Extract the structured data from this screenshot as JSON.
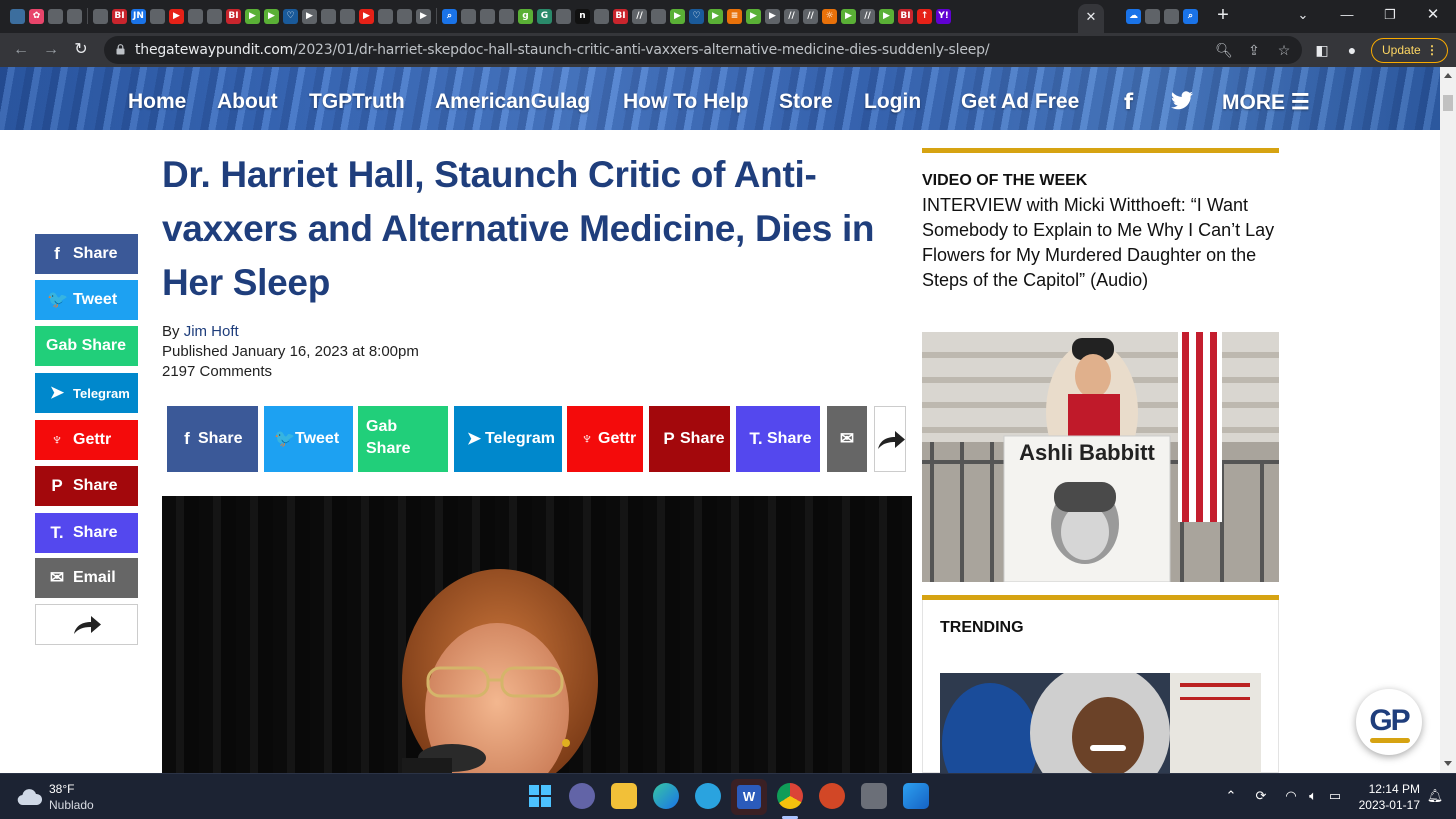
{
  "browser": {
    "active_tab_icon": "close-icon",
    "new_tab_label": "+",
    "url_domain": "thegatewaypundit.com",
    "url_path": "/2023/01/dr-harriet-skepdoc-hall-staunch-critic-anti-vaxxers-alternative-medicine-dies-suddenly-sleep/",
    "update_label": "Update",
    "favicons": [
      {
        "t": "",
        "c": "#3c6e9e"
      },
      {
        "t": "✿",
        "c": "#e8456b"
      },
      {
        "t": "",
        "c": "#5f6368"
      },
      {
        "t": "",
        "c": "#5f6368"
      },
      {
        "sep": true
      },
      {
        "t": "",
        "c": "#5f6368"
      },
      {
        "t": "BI",
        "c": "#c9252d"
      },
      {
        "t": "JN",
        "c": "#1a73e8"
      },
      {
        "t": "",
        "c": "#5f6368"
      },
      {
        "t": "▶",
        "c": "#e62117"
      },
      {
        "t": "",
        "c": "#5f6368"
      },
      {
        "t": "",
        "c": "#5f6368"
      },
      {
        "t": "BI",
        "c": "#c9252d"
      },
      {
        "t": "▶",
        "c": "#5ab036"
      },
      {
        "t": "▶",
        "c": "#5ab036"
      },
      {
        "t": "♡",
        "c": "#1a5a9a"
      },
      {
        "t": "▶",
        "c": "#5f6368"
      },
      {
        "t": "",
        "c": "#5f6368"
      },
      {
        "t": "",
        "c": "#5f6368"
      },
      {
        "t": "▶",
        "c": "#e62117"
      },
      {
        "t": "",
        "c": "#5f6368"
      },
      {
        "t": "",
        "c": "#5f6368"
      },
      {
        "t": "▶",
        "c": "#5f6368"
      },
      {
        "sep": true
      },
      {
        "t": "⌕",
        "c": "#1a73e8"
      },
      {
        "t": "",
        "c": "#5f6368"
      },
      {
        "t": "",
        "c": "#5f6368"
      },
      {
        "t": "",
        "c": "#5f6368"
      },
      {
        "t": "g",
        "c": "#5ab036"
      },
      {
        "t": "G",
        "c": "#2a8a6a"
      },
      {
        "t": "",
        "c": "#5f6368"
      },
      {
        "t": "n",
        "c": "#111111"
      },
      {
        "t": "",
        "c": "#5f6368"
      },
      {
        "t": "BI",
        "c": "#c9252d"
      },
      {
        "t": "//",
        "c": "#5f6368"
      },
      {
        "t": "",
        "c": "#5f6368"
      },
      {
        "t": "▶",
        "c": "#5ab036"
      },
      {
        "t": "♡",
        "c": "#1a5a9a"
      },
      {
        "t": "▶",
        "c": "#5ab036"
      },
      {
        "t": "≡",
        "c": "#e8710a"
      },
      {
        "t": "▶",
        "c": "#5ab036"
      },
      {
        "t": "▶",
        "c": "#5f6368"
      },
      {
        "t": "//",
        "c": "#5f6368"
      },
      {
        "t": "//",
        "c": "#5f6368"
      },
      {
        "t": "☼",
        "c": "#e8710a"
      },
      {
        "t": "▶",
        "c": "#5ab036"
      },
      {
        "t": "//",
        "c": "#5f6368"
      },
      {
        "t": "▶",
        "c": "#5ab036"
      },
      {
        "t": "BI",
        "c": "#c9252d"
      },
      {
        "t": "↑",
        "c": "#e62117"
      },
      {
        "t": "Y!",
        "c": "#6001d2"
      }
    ],
    "favicons_after": [
      {
        "t": "☁",
        "c": "#1a73e8"
      },
      {
        "t": "",
        "c": "#5f6368"
      },
      {
        "t": "",
        "c": "#5f6368"
      },
      {
        "t": "⌕",
        "c": "#1a73e8"
      }
    ]
  },
  "site_nav": {
    "items": [
      "Home",
      "About",
      "TGPTruth",
      "AmericanGulag",
      "How To Help",
      "Store",
      "Login",
      "Get Ad Free"
    ],
    "facebook_icon": "f",
    "more_label": "MORE"
  },
  "left_share": [
    {
      "label": "Share",
      "icon": "facebook-icon",
      "glyph": "f",
      "color": "#3b5998"
    },
    {
      "label": "Tweet",
      "icon": "twitter-icon",
      "glyph": "🐦",
      "color": "#1da1f2"
    },
    {
      "label": "Gab Share",
      "icon": "",
      "glyph": "",
      "color": "#21cf7a"
    },
    {
      "label": "Telegram",
      "icon": "telegram-icon",
      "glyph": "➤",
      "color": "#0088cc"
    },
    {
      "label": "Gettr",
      "icon": "gettr-icon",
      "glyph": "♆",
      "color": "#f40b0b"
    },
    {
      "label": "Share",
      "icon": "parler-icon",
      "glyph": "P",
      "color": "#a3080c"
    },
    {
      "label": "Share",
      "icon": "truth-social-icon",
      "glyph": "T.",
      "color": "#5448ee"
    },
    {
      "label": "Email",
      "icon": "envelope-icon",
      "glyph": "✉",
      "color": "#666666"
    }
  ],
  "article": {
    "title": "Dr. Harriet Hall, Staunch Critic of Anti-vaxxers and Alternative Medicine, Dies in Her Sleep",
    "by_label": "By",
    "author": "Jim Hoft",
    "published": "Published January 16, 2023 at 8:00pm",
    "comments": "2197 Comments"
  },
  "share_bar": [
    {
      "label": "Share",
      "glyph": "f",
      "color": "#3b5998"
    },
    {
      "label": "Tweet",
      "glyph": "🐦",
      "color": "#1da1f2"
    },
    {
      "label": "Gab Share",
      "glyph": "",
      "color": "#21cf7a"
    },
    {
      "label": "Telegram",
      "glyph": "➤",
      "color": "#0088cc"
    },
    {
      "label": "Gettr",
      "glyph": "♆",
      "color": "#f40b0b"
    },
    {
      "label": "Share",
      "glyph": "P",
      "color": "#a3080c"
    },
    {
      "label": "Share",
      "glyph": "T.",
      "color": "#5448ee"
    },
    {
      "label": "",
      "glyph": "✉",
      "color": "#666666"
    }
  ],
  "sidebar": {
    "video_heading": "VIDEO OF THE WEEK",
    "video_title": "INTERVIEW with Micki Witthoeft: “I Want Somebody to Explain to Me Why I Can’t Lay Flowers for My Murdered Daughter on the Steps of the Capitol” (Audio)",
    "sign_text": "Ashli Babbitt",
    "trending_heading": "TRENDING"
  },
  "floating_logo": "GP",
  "taskbar": {
    "temperature": "38°F",
    "weather": "Nublado",
    "time": "12:14 PM",
    "date": "2023-01-17"
  },
  "colors": {
    "brand_blue": "#1f3e7c",
    "accent_gold": "#d6a312",
    "chrome_dark": "#202124"
  }
}
